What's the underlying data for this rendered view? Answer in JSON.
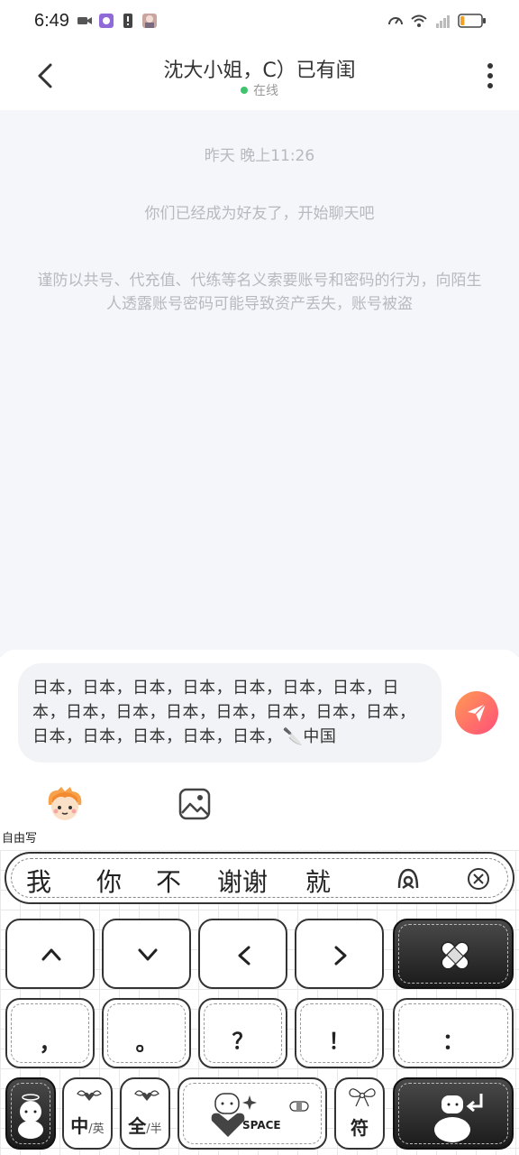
{
  "status_bar": {
    "time": "6:49",
    "battery_level": 0.2,
    "colors": {
      "battery": "#f3a227"
    }
  },
  "header": {
    "title": "沈大小姐，C）已有闺",
    "online_label": "在线",
    "online_color": "#3ec46d"
  },
  "chat": {
    "timestamp": "昨天 晚上11:26",
    "friend_notice": "你们已经成为好友了，开始聊天吧",
    "security_warning": "谨防以共号、代充值、代练等名义索要账号和密码的行为，向陌生人透露账号密码可能导致资产丢失，账号被盗"
  },
  "composer": {
    "text": "日本，日本，日本，日本，日本，日本，日本，日本，日本，日本，日本，日本，日本，日本，日本，日本，日本，日本，日本，日本，🔪中国",
    "send_icon": "paper-plane-icon",
    "tools": [
      {
        "name": "sticker-avatar-icon",
        "label": ""
      },
      {
        "name": "image-icon",
        "label": ""
      }
    ],
    "free_write_label": "自由写",
    "colors": {
      "send_gradient_start": "#ff9a54",
      "send_gradient_end": "#ff4f78"
    }
  },
  "keyboard": {
    "candidates": [
      "我",
      "你",
      "不",
      "谢谢",
      "就"
    ],
    "row1": {
      "keys": [
        "up-arrow-icon",
        "down-arrow-icon",
        "left-arrow-icon",
        "right-arrow-icon"
      ],
      "delete_icon": "bandage-delete-icon"
    },
    "row2": {
      "keys": [
        "，",
        "。",
        "？",
        "！",
        "："
      ]
    },
    "row3": {
      "zh_en_main": "中",
      "zh_en_sub": "/英",
      "full_half_main": "全",
      "full_half_sub": "/半",
      "space_label": "SPACE",
      "symbol_label": "符"
    }
  }
}
